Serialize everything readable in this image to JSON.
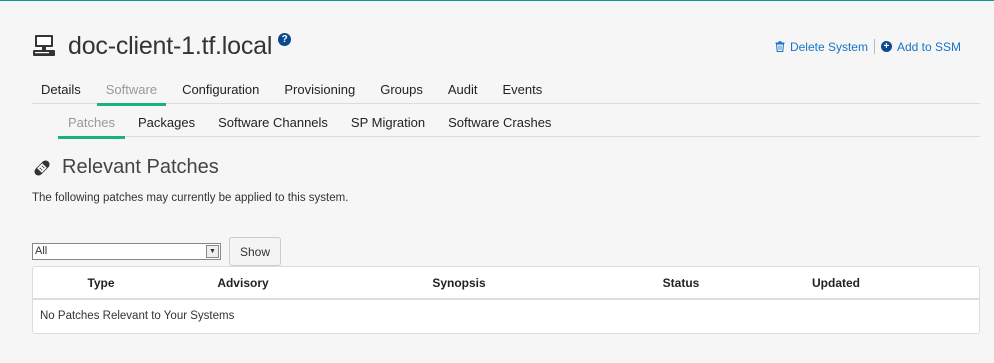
{
  "header": {
    "title": "doc-client-1.tf.local",
    "help": "?",
    "actions": {
      "delete_system": "Delete System",
      "add_to_ssm": "Add to SSM"
    }
  },
  "tabs": [
    {
      "label": "Details"
    },
    {
      "label": "Software",
      "active": true
    },
    {
      "label": "Configuration"
    },
    {
      "label": "Provisioning"
    },
    {
      "label": "Groups"
    },
    {
      "label": "Audit"
    },
    {
      "label": "Events"
    }
  ],
  "subtabs": [
    {
      "label": "Patches",
      "active": true
    },
    {
      "label": "Packages"
    },
    {
      "label": "Software Channels"
    },
    {
      "label": "SP Migration"
    },
    {
      "label": "Software Crashes"
    }
  ],
  "section": {
    "title": "Relevant Patches",
    "description": "The following patches may currently be applied to this system."
  },
  "filter": {
    "selected": "All",
    "show_label": "Show"
  },
  "table": {
    "columns": [
      "Type",
      "Advisory",
      "Synopsis",
      "Status",
      "Updated"
    ],
    "empty_message": "No Patches Relevant to Your Systems"
  },
  "colors": {
    "accent": "#1db27a",
    "link": "#1a73c7"
  }
}
